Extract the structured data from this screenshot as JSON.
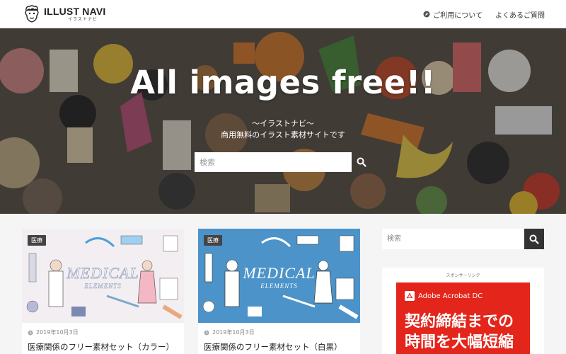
{
  "header": {
    "logo_title": "ILLUST NAVI",
    "logo_subtitle": "イラストナビ",
    "nav": [
      {
        "label": "ご利用について",
        "icon": "compass-icon"
      },
      {
        "label": "よくあるご質問"
      }
    ]
  },
  "hero": {
    "title": "All images free!!",
    "subtitle": "〜イラストナビ〜",
    "tagline": "商用無料のイラスト素材サイトです",
    "search_placeholder": "検索",
    "search_icon": "search-icon"
  },
  "posts": [
    {
      "category": "医療",
      "image_text": "MEDICAL",
      "image_subtext": "ELEMENTS",
      "date": "2019年10月3日",
      "title": "医療関係のフリー素材セット（カラー）",
      "image_bg": "#f2eef1"
    },
    {
      "category": "医療",
      "image_text": "MEDICAL",
      "image_subtext": "ELEMENTS",
      "date": "2019年10月3日",
      "title": "医療関係のフリー素材セット（白黒）",
      "image_bg": "#4c93c9"
    }
  ],
  "sidebar": {
    "search_placeholder": "検索",
    "sponsor_label": "スポンサーリンク",
    "ad": {
      "brand": "Adobe Acrobat DC",
      "line1": "契約締結までの",
      "line2": "時間を大幅短縮",
      "color": "#e3251b"
    }
  },
  "colors": {
    "accent_dark": "#333333",
    "background": "#f5f5f5"
  }
}
